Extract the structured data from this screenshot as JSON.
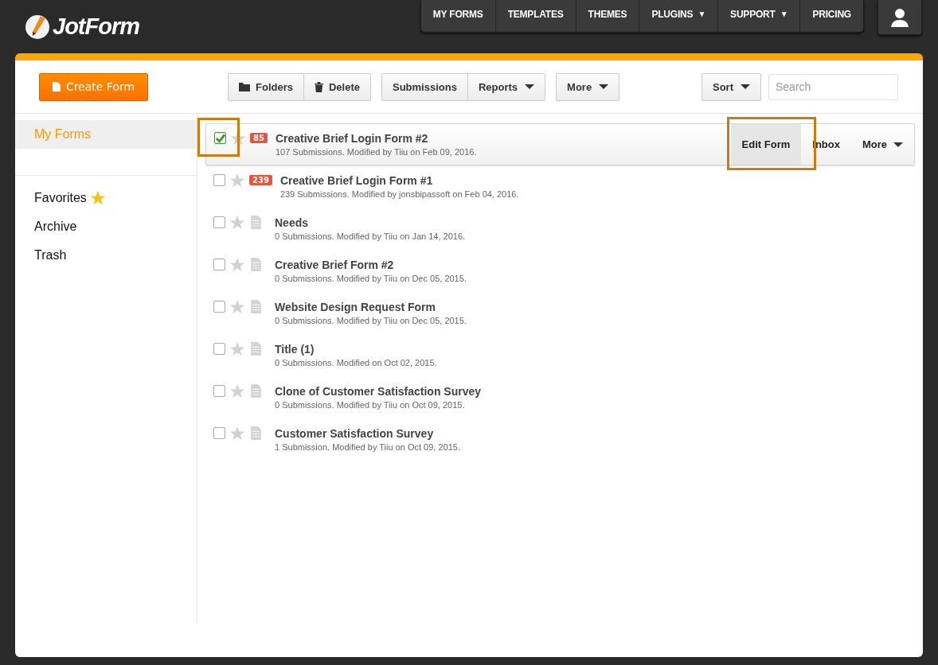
{
  "logo": "JotForm",
  "nav": [
    {
      "label": "MY FORMS"
    },
    {
      "label": "TEMPLATES"
    },
    {
      "label": "THEMES"
    },
    {
      "label": "PLUGINS",
      "arrow": "▼"
    },
    {
      "label": "SUPPORT",
      "arrow": "▼"
    },
    {
      "label": "PRICING"
    }
  ],
  "toolbar": {
    "create": "Create Form",
    "groups": [
      [
        {
          "label": "Folders",
          "kind": "folder",
          "caret": false
        },
        {
          "label": "Delete",
          "kind": "trash",
          "caret": false
        }
      ],
      [
        {
          "label": "Submissions",
          "kind": "plain",
          "caret": false
        },
        {
          "label": "Reports",
          "kind": "plain",
          "caret": true
        }
      ],
      [
        {
          "label": "More",
          "kind": "plain",
          "caret": true
        }
      ]
    ],
    "sort": "Sort",
    "search": {
      "placeholder": "Search"
    }
  },
  "sidebar": {
    "items": [
      {
        "label": "My Forms",
        "selected": true,
        "star": false
      },
      {
        "label": "Favorites",
        "selected": false,
        "star": true
      },
      {
        "label": "Archive",
        "selected": false,
        "star": false
      },
      {
        "label": "Trash",
        "selected": false,
        "star": false
      }
    ]
  },
  "forms": [
    {
      "title": "Creative Brief Login Form #2",
      "meta": "107 Submissions. Modified by Tiiu on Feb 09, 2016.",
      "badge": "85",
      "checked": true,
      "selected": true,
      "highlighted": true
    },
    {
      "title": "Creative Brief Login Form #1",
      "meta": "239 Submissions. Modified by jonsbipassoft on Feb 04, 2016.",
      "badge": "239",
      "checked": false,
      "selected": false,
      "highlighted": false
    },
    {
      "title": "Needs",
      "meta": "0 Submissions. Modified by Tiiu on Jan 14, 2016.",
      "checked": false,
      "selected": false,
      "highlighted": false
    },
    {
      "title": "Creative Brief Form #2",
      "meta": "0 Submissions. Modified by Tiiu on Dec 05, 2015.",
      "checked": false,
      "selected": false,
      "highlighted": false
    },
    {
      "title": "Website Design Request Form",
      "meta": "0 Submissions. Modified by Tiiu on Dec 05, 2015.",
      "checked": false,
      "selected": false,
      "highlighted": false
    },
    {
      "title": "Title (1)",
      "meta": "0 Submissions. Modified on Oct 02, 2015.",
      "checked": false,
      "selected": false,
      "highlighted": false
    },
    {
      "title": "Clone of Customer Satisfaction Survey",
      "meta": "0 Submissions. Modified by Tiiu on Oct 09, 2015.",
      "checked": false,
      "selected": false,
      "highlighted": false
    },
    {
      "title": "Customer Satisfaction Survey",
      "meta": "1 Submission. Modified by Tiiu on Oct 09, 2015.",
      "checked": false,
      "selected": false,
      "highlighted": false
    }
  ],
  "row_actions": [
    {
      "label": "Edit Form",
      "highlighted": true,
      "caret": false
    },
    {
      "label": "Inbox",
      "highlighted": false,
      "caret": false
    },
    {
      "label": "More",
      "highlighted": false,
      "caret": true
    }
  ]
}
